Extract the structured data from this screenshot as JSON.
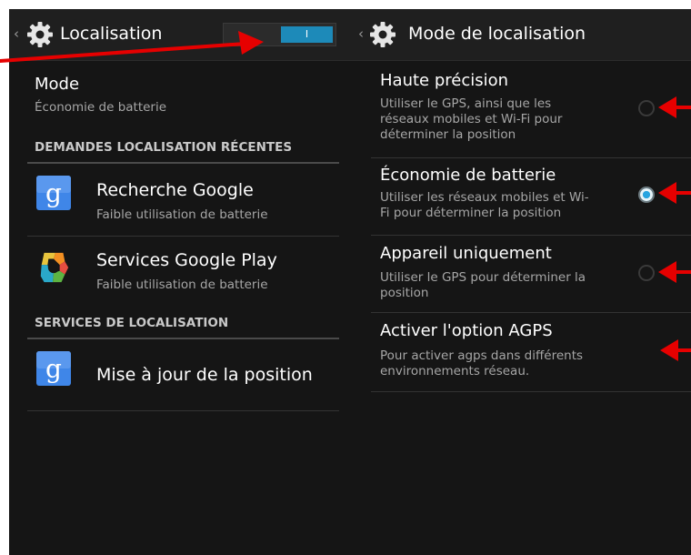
{
  "left_panel": {
    "actionbar": {
      "back_glyph": "‹",
      "title": "Localisation",
      "toggle_label": "I",
      "toggle_on": true
    },
    "mode": {
      "title": "Mode",
      "value": "Économie de batterie"
    },
    "recent_section": {
      "header": "DEMANDES LOCALISATION RÉCENTES",
      "items": [
        {
          "title": "Recherche Google",
          "subtitle": "Faible utilisation de batterie",
          "icon": "google-search-icon"
        },
        {
          "title": "Services Google Play",
          "subtitle": "Faible utilisation de batterie",
          "icon": "google-play-services-icon"
        }
      ]
    },
    "services_section": {
      "header": "SERVICES DE LOCALISATION",
      "items": [
        {
          "title": "Mise à jour de la position",
          "icon": "google-search-icon"
        }
      ]
    }
  },
  "right_panel": {
    "actionbar": {
      "back_glyph": "‹",
      "title": "Mode de localisation"
    },
    "options": [
      {
        "title": "Haute précision",
        "desc_lines": [
          "Utiliser le GPS, ainsi que les",
          "réseaux mobiles et Wi-Fi pour",
          "déterminer la position"
        ],
        "selected": false
      },
      {
        "title": "Économie de batterie",
        "desc_lines": [
          "Utiliser les réseaux mobiles et Wi-",
          "Fi pour déterminer la position"
        ],
        "selected": true
      },
      {
        "title": "Appareil uniquement",
        "desc_lines": [
          "Utiliser le GPS pour déterminer la",
          "position"
        ],
        "selected": false
      },
      {
        "title": "Activer l'option AGPS",
        "desc_lines": [
          "Pour activer agps dans différents",
          "environnements réseau."
        ]
      }
    ]
  },
  "annotations": {
    "arrow_color": "#e60000"
  },
  "colors": {
    "background": "#151515",
    "accent": "#1d8ab9",
    "google_blue": "#3f86e8"
  }
}
